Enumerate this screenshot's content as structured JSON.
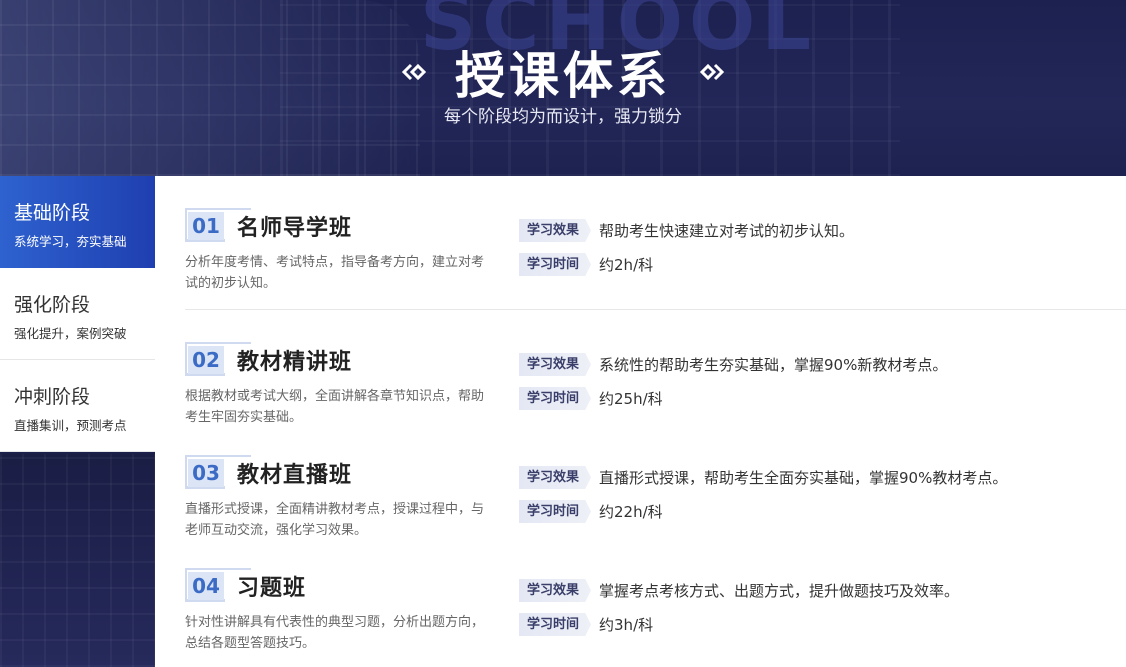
{
  "header": {
    "watermark": "SCHOOL",
    "title": "授课体系",
    "subtitle": "每个阶段均为而设计，强力锁分"
  },
  "tabs": [
    {
      "label": "基础阶段",
      "sub": "系统学习，夯实基础"
    },
    {
      "label": "强化阶段",
      "sub": "强化提升，案例突破"
    },
    {
      "label": "冲刺阶段",
      "sub": "直播集训，预测考点"
    }
  ],
  "active_tab": 0,
  "courses": [
    {
      "num": "01",
      "name": "名师导学班",
      "desc": "分析年度考情、考试特点，指导备考方向，建立对考试的初步认知。",
      "effect_label": "学习效果",
      "effect": "帮助考生快速建立对考试的初步认知。",
      "time_label": "学习时间",
      "time": "约2h/科"
    },
    {
      "num": "02",
      "name": "教材精讲班",
      "desc": "根据教材或考试大纲，全面讲解各章节知识点，帮助考生牢固夯实基础。",
      "effect_label": "学习效果",
      "effect": "系统性的帮助考生夯实基础，掌握90%新教材考点。",
      "time_label": "学习时间",
      "time": "约25h/科"
    },
    {
      "num": "03",
      "name": "教材直播班",
      "desc": "直播形式授课，全面精讲教材考点，授课过程中，与老师互动交流，强化学习效果。",
      "effect_label": "学习效果",
      "effect": "直播形式授课，帮助考生全面夯实基础，掌握90%教材考点。",
      "time_label": "学习时间",
      "time": "约22h/科"
    },
    {
      "num": "04",
      "name": "习题班",
      "desc": "针对性讲解具有代表性的典型习题，分析出题方向，总结各题型答题技巧。",
      "effect_label": "学习效果",
      "effect": "掌握考点考核方式、出题方式，提升做题技巧及效率。",
      "time_label": "学习时间",
      "time": "约3h/科"
    }
  ],
  "colors": {
    "header_bg": "#1d2150",
    "active_tab": "#2e62cf",
    "number_text": "#3c6bc6",
    "number_bg": "#dce5f6",
    "tag_bg": "#e4e8f4"
  }
}
